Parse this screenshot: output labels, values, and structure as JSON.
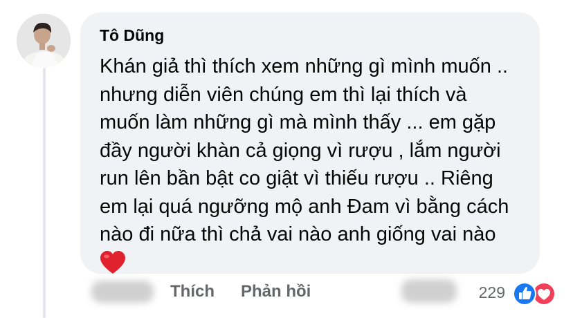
{
  "comment": {
    "author": "Tô Dũng",
    "lines": [
      "Khán giả thì thích xem những gì mình muốn ..",
      "nhưng diễn viên chúng em thì lại thích và",
      "muốn làm những gì mà mình thấy ... em gặp",
      "đầy người khàn cả giọng vì rượu , lắm người",
      "run lên bần bật co giật vì thiếu rượu .. Riêng",
      "em lại quá ngưỡng mộ anh Đam vì bằng cách",
      "nào đi nữa thì chả vai nào anh giống vai nào"
    ],
    "trailing_emoji": "red-heart-emoji"
  },
  "actions": {
    "like_label": "Thích",
    "reply_label": "Phản hồi"
  },
  "reactions": {
    "count": "229",
    "icons": [
      "like-reaction-icon",
      "love-reaction-icon"
    ],
    "colors": {
      "like": "#1877f2",
      "love": "#f33e58"
    }
  }
}
